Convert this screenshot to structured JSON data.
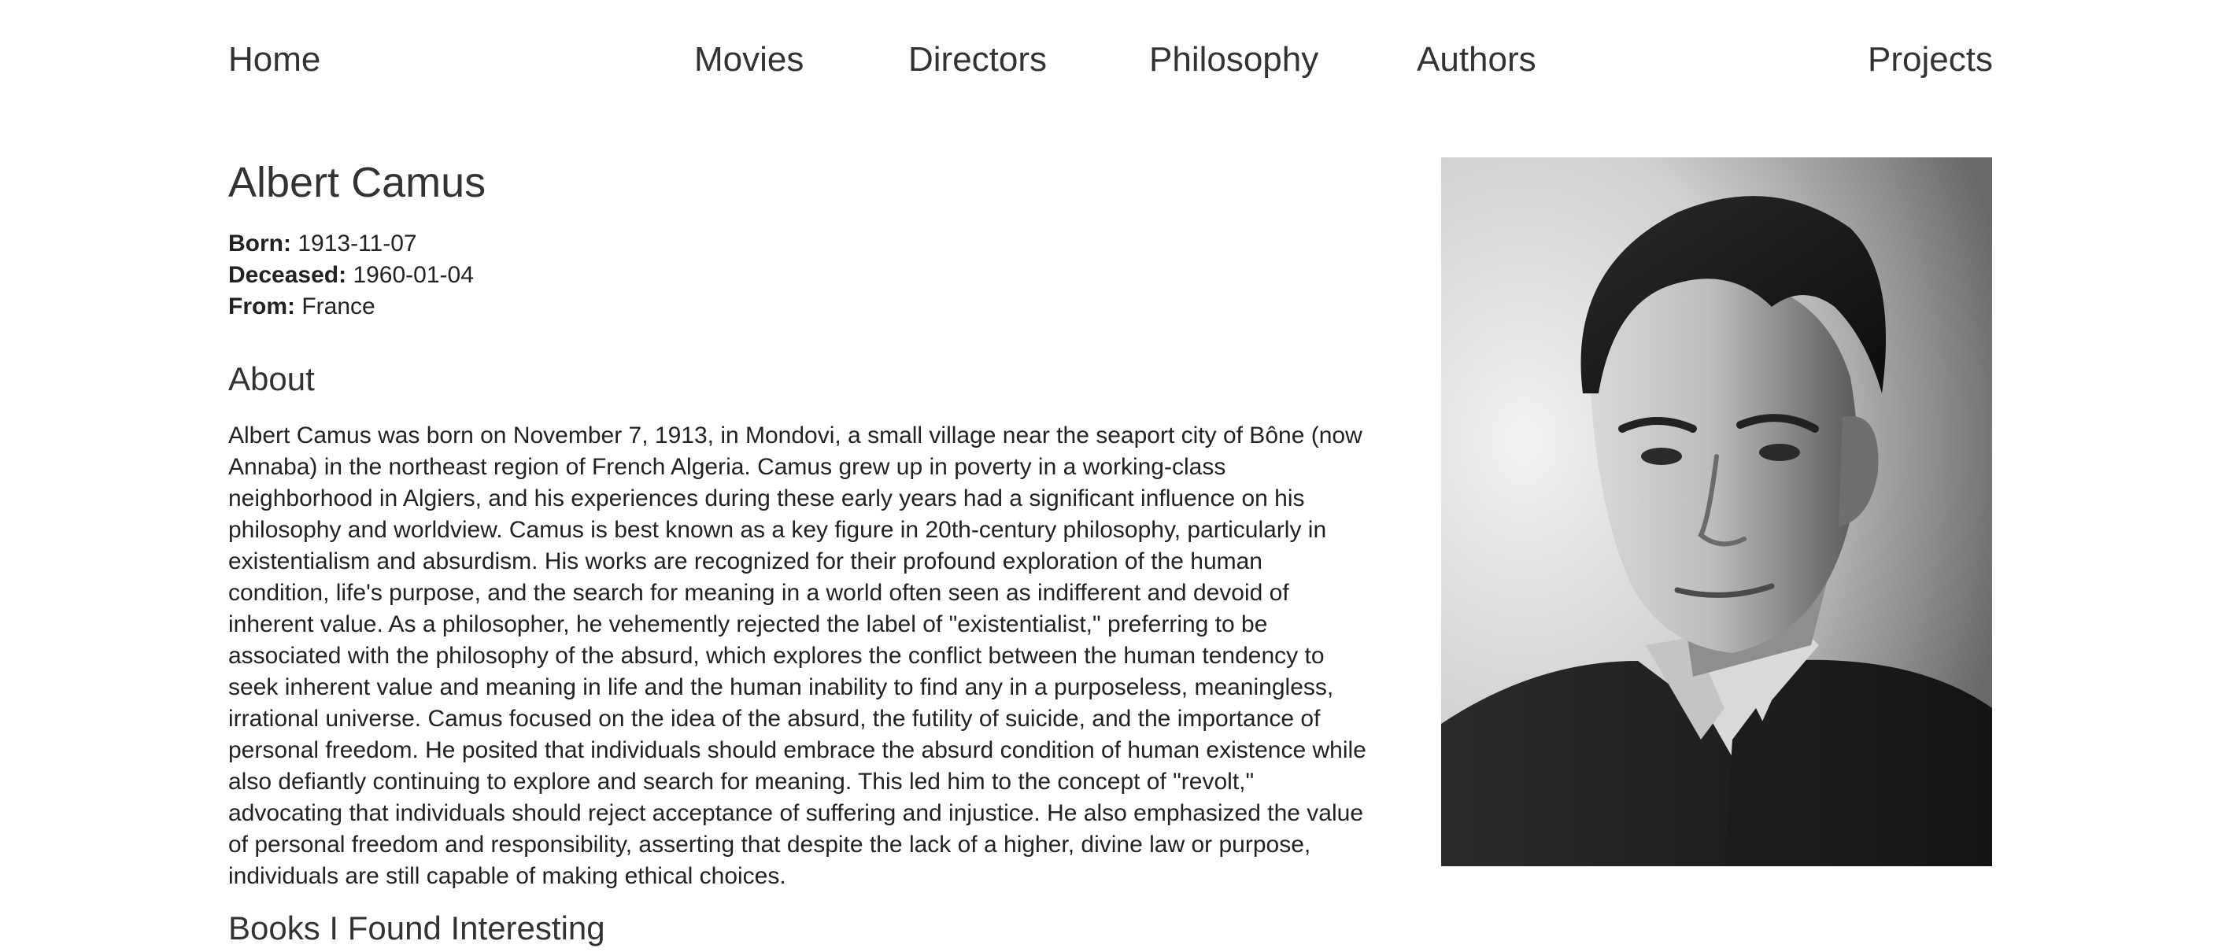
{
  "nav": {
    "home": "Home",
    "movies": "Movies",
    "directors": "Directors",
    "philosophy": "Philosophy",
    "authors": "Authors",
    "projects": "Projects"
  },
  "author": {
    "name": "Albert Camus",
    "born_label": "Born:",
    "born": "1913-11-07",
    "deceased_label": "Deceased:",
    "deceased": "1960-01-04",
    "from_label": "From:",
    "from": "France"
  },
  "about": {
    "heading": "About",
    "text": "Albert Camus was born on November 7, 1913, in Mondovi, a small village near the seaport city of Bône (now Annaba) in the northeast region of French Algeria. Camus grew up in poverty in a working-class neighborhood in Algiers, and his experiences during these early years had a significant influence on his philosophy and worldview. Camus is best known as a key figure in 20th-century philosophy, particularly in existentialism and absurdism. His works are recognized for their profound exploration of the human condition, life's purpose, and the search for meaning in a world often seen as indifferent and devoid of inherent value. As a philosopher, he vehemently rejected the label of \"existentialist,\" preferring to be associated with the philosophy of the absurd, which explores the conflict between the human tendency to seek inherent value and meaning in life and the human inability to find any in a purposeless, meaningless, irrational universe. Camus focused on the idea of the absurd, the futility of suicide, and the importance of personal freedom. He posited that individuals should embrace the absurd condition of human existence while also defiantly continuing to explore and search for meaning. This led him to the concept of \"revolt,\" advocating that individuals should reject acceptance of suffering and injustice. He also emphasized the value of personal freedom and responsibility, asserting that despite the lack of a higher, divine law or purpose, individuals are still capable of making ethical choices."
  },
  "books": {
    "heading": "Books I Found Interesting"
  },
  "portrait": {
    "subject": "black-and-white portrait photo of a man in a suit and tie"
  }
}
